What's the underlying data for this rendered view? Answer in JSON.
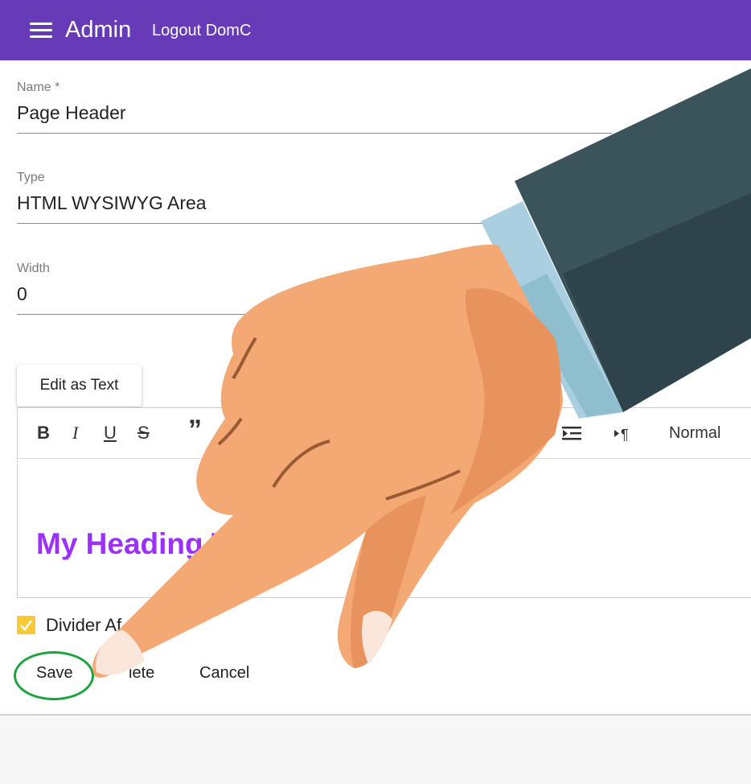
{
  "header": {
    "title": "Admin",
    "logout_label": "Logout DomC"
  },
  "form": {
    "name": {
      "label": "Name *",
      "value": "Page Header"
    },
    "type": {
      "label": "Type",
      "value": "HTML WYSIWYG Area"
    },
    "width": {
      "label": "Width",
      "value": "0"
    }
  },
  "editor": {
    "edit_as_text_label": "Edit as Text",
    "toolbar": {
      "bold": "B",
      "italic": "I",
      "underline": "U",
      "strike": "S",
      "quote": "”",
      "format": "Normal"
    },
    "content": "My Heading T"
  },
  "divider": {
    "label": "Divider Af",
    "checked": true
  },
  "actions": {
    "save": "Save",
    "delete": "lete",
    "cancel": "Cancel"
  },
  "colors": {
    "appbar": "#673ab7",
    "heading": "#9b30ff",
    "checkbox": "#f8c933",
    "highlight": "#1fa33f"
  }
}
